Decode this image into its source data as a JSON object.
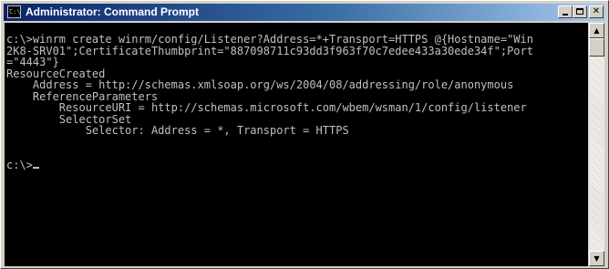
{
  "window": {
    "title": "Administrator: Command Prompt",
    "icon_label": "C:\\",
    "buttons": {
      "minimize": "minimize-icon",
      "maximize": "maximize-icon",
      "close": "✕"
    }
  },
  "console": {
    "lines": [
      "c:\\>winrm create winrm/config/Listener?Address=*+Transport=HTTPS @{Hostname=\"Win",
      "2K8-SRV01\";CertificateThumbprint=\"887098711c93dd3f963f70c7edee433a30ede34f\";Port",
      "=\"4443\"}",
      "ResourceCreated",
      "    Address = http://schemas.xmlsoap.org/ws/2004/08/addressing/role/anonymous",
      "    ReferenceParameters",
      "        ResourceURI = http://schemas.microsoft.com/wbem/wsman/1/config/listener",
      "        SelectorSet",
      "            Selector: Address = *, Transport = HTTPS",
      "",
      "",
      "c:\\>"
    ]
  },
  "scrollbar": {
    "up_arrow": "▲",
    "down_arrow": "▼"
  },
  "colors": {
    "titlebar_start": "#0a246a",
    "titlebar_end": "#a6caf0",
    "console_bg": "#000000",
    "console_fg": "#c0c0c0"
  }
}
